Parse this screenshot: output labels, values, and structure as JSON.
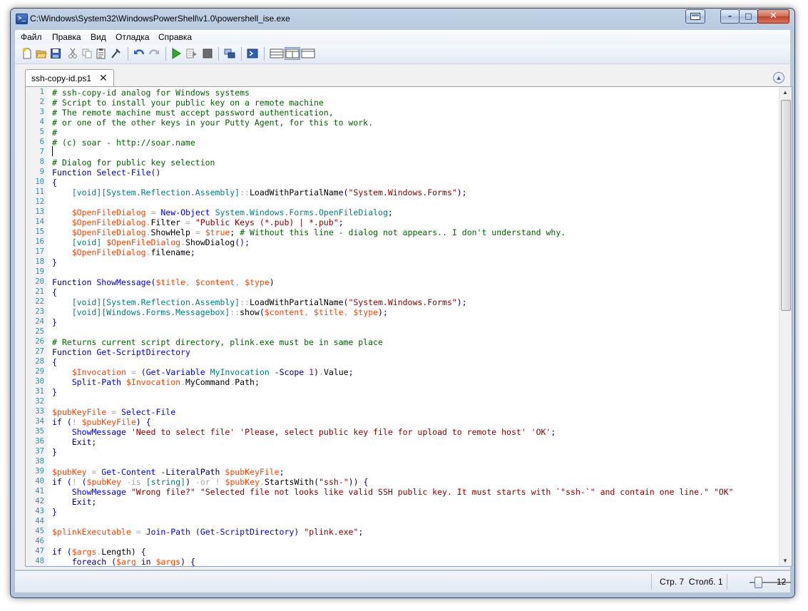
{
  "window": {
    "title": "C:\\Windows\\System32\\WindowsPowerShell\\v1.0\\powershell_ise.exe",
    "min_glyph": "–",
    "max_glyph": "□",
    "close_glyph": "✕"
  },
  "menu": [
    "Файл",
    "Правка",
    "Вид",
    "Отладка",
    "Справка"
  ],
  "tab": {
    "label": "ssh-copy-id.ps1",
    "close_glyph": "✕"
  },
  "editor": {
    "line_numbers": [
      "1",
      "2",
      "3",
      "4",
      "5",
      "6",
      "7",
      "8",
      "9",
      "10",
      "11",
      "12",
      "13",
      "14",
      "15",
      "16",
      "17",
      "18",
      "19",
      "20",
      "21",
      "22",
      "23",
      "24",
      "25",
      "26",
      "27",
      "28",
      "29",
      "30",
      "31",
      "32",
      "33",
      "34",
      "35",
      "36",
      "37",
      "38",
      "39",
      "40",
      "41",
      "42",
      "43",
      "44",
      "45",
      "46",
      "47",
      "48"
    ],
    "lines": [
      [
        [
          "c",
          "# ssh-copy-id analog for Windows systems"
        ]
      ],
      [
        [
          "c",
          "# Script to install your public key on a remote machine"
        ]
      ],
      [
        [
          "c",
          "# The remote machine must accept password authentication,"
        ]
      ],
      [
        [
          "c",
          "# or one of the other keys in your Putty Agent, for this to work."
        ]
      ],
      [
        [
          "c",
          "#"
        ]
      ],
      [
        [
          "c",
          "# (c) soar - http://soar.name"
        ]
      ],
      [],
      [
        [
          "c",
          "# Dialog for public key selection"
        ]
      ],
      [
        [
          "k",
          "Function"
        ],
        [
          "t",
          " "
        ],
        [
          "n",
          "Select-File"
        ],
        [
          "p",
          "()"
        ]
      ],
      [
        [
          "p",
          "{"
        ]
      ],
      [
        [
          "t",
          "    "
        ],
        [
          "y",
          "[void][System.Reflection.Assembly]"
        ],
        [
          "o",
          "::"
        ],
        [
          "m",
          "LoadWithPartialName"
        ],
        [
          "p",
          "("
        ],
        [
          "s",
          "\"System.Windows.Forms\""
        ],
        [
          "p",
          ");"
        ]
      ],
      [],
      [
        [
          "t",
          "    "
        ],
        [
          "v",
          "$OpenFileDialog"
        ],
        [
          "t",
          " "
        ],
        [
          "o",
          "="
        ],
        [
          "t",
          " "
        ],
        [
          "d",
          "New-Object"
        ],
        [
          "t",
          " "
        ],
        [
          "a",
          "System.Windows.Forms.OpenFileDialog"
        ],
        [
          "p",
          ";"
        ]
      ],
      [
        [
          "t",
          "    "
        ],
        [
          "v",
          "$OpenFileDialog"
        ],
        [
          "o",
          "."
        ],
        [
          "m",
          "Filter"
        ],
        [
          "t",
          " "
        ],
        [
          "o",
          "="
        ],
        [
          "t",
          " "
        ],
        [
          "s",
          "\"Public Keys (*.pub) | *.pub\""
        ],
        [
          "p",
          ";"
        ]
      ],
      [
        [
          "t",
          "    "
        ],
        [
          "v",
          "$OpenFileDialog"
        ],
        [
          "o",
          "."
        ],
        [
          "m",
          "ShowHelp"
        ],
        [
          "t",
          " "
        ],
        [
          "o",
          "="
        ],
        [
          "t",
          " "
        ],
        [
          "v",
          "$true"
        ],
        [
          "p",
          ";"
        ],
        [
          "t",
          " "
        ],
        [
          "c",
          "# Without this line - dialog not appears.. I don't understand why."
        ]
      ],
      [
        [
          "t",
          "    "
        ],
        [
          "y",
          "[void]"
        ],
        [
          "t",
          " "
        ],
        [
          "v",
          "$OpenFileDialog"
        ],
        [
          "o",
          "."
        ],
        [
          "m",
          "ShowDialog"
        ],
        [
          "p",
          "();"
        ]
      ],
      [
        [
          "t",
          "    "
        ],
        [
          "v",
          "$OpenFileDialog"
        ],
        [
          "o",
          "."
        ],
        [
          "m",
          "filename"
        ],
        [
          "p",
          ";"
        ]
      ],
      [
        [
          "p",
          "}"
        ]
      ],
      [],
      [
        [
          "k",
          "Function"
        ],
        [
          "t",
          " "
        ],
        [
          "n",
          "ShowMessage"
        ],
        [
          "p",
          "("
        ],
        [
          "v",
          "$title"
        ],
        [
          "o",
          ", "
        ],
        [
          "v",
          "$content"
        ],
        [
          "o",
          ", "
        ],
        [
          "v",
          "$type"
        ],
        [
          "p",
          ")"
        ]
      ],
      [
        [
          "p",
          "{"
        ]
      ],
      [
        [
          "t",
          "    "
        ],
        [
          "y",
          "[void][System.Reflection.Assembly]"
        ],
        [
          "o",
          "::"
        ],
        [
          "m",
          "LoadWithPartialName"
        ],
        [
          "p",
          "("
        ],
        [
          "s",
          "\"System.Windows.Forms\""
        ],
        [
          "p",
          ");"
        ]
      ],
      [
        [
          "t",
          "    "
        ],
        [
          "y",
          "[void][Windows.Forms.Messagebox]"
        ],
        [
          "o",
          "::"
        ],
        [
          "m",
          "show"
        ],
        [
          "p",
          "("
        ],
        [
          "v",
          "$content"
        ],
        [
          "o",
          ", "
        ],
        [
          "v",
          "$title"
        ],
        [
          "o",
          ", "
        ],
        [
          "v",
          "$type"
        ],
        [
          "p",
          ");"
        ]
      ],
      [
        [
          "p",
          "}"
        ]
      ],
      [],
      [
        [
          "c",
          "# Returns current script directory, plink.exe must be in same place"
        ]
      ],
      [
        [
          "k",
          "Function"
        ],
        [
          "t",
          " "
        ],
        [
          "n",
          "Get-ScriptDirectory"
        ]
      ],
      [
        [
          "p",
          "{"
        ]
      ],
      [
        [
          "t",
          "    "
        ],
        [
          "v",
          "$Invocation"
        ],
        [
          "t",
          " "
        ],
        [
          "o",
          "="
        ],
        [
          "t",
          " "
        ],
        [
          "p",
          "("
        ],
        [
          "d",
          "Get-Variable"
        ],
        [
          "t",
          " "
        ],
        [
          "a",
          "MyInvocation"
        ],
        [
          "t",
          " "
        ],
        [
          "e",
          "-Scope"
        ],
        [
          "t",
          " "
        ],
        [
          "u",
          "1"
        ],
        [
          "p",
          ")"
        ],
        [
          "o",
          "."
        ],
        [
          "m",
          "Value"
        ],
        [
          "p",
          ";"
        ]
      ],
      [
        [
          "t",
          "    "
        ],
        [
          "d",
          "Split-Path"
        ],
        [
          "t",
          " "
        ],
        [
          "v",
          "$Invocation"
        ],
        [
          "o",
          "."
        ],
        [
          "m",
          "MyCommand"
        ],
        [
          "o",
          "."
        ],
        [
          "m",
          "Path"
        ],
        [
          "p",
          ";"
        ]
      ],
      [
        [
          "p",
          "}"
        ]
      ],
      [],
      [
        [
          "v",
          "$pubKeyFile"
        ],
        [
          "t",
          " "
        ],
        [
          "o",
          "="
        ],
        [
          "t",
          " "
        ],
        [
          "d",
          "Select-File"
        ]
      ],
      [
        [
          "k",
          "if"
        ],
        [
          "t",
          " "
        ],
        [
          "p",
          "("
        ],
        [
          "o",
          "!"
        ],
        [
          "t",
          " "
        ],
        [
          "v",
          "$pubKeyFile"
        ],
        [
          "p",
          ")"
        ],
        [
          "t",
          " "
        ],
        [
          "p",
          "{"
        ]
      ],
      [
        [
          "t",
          "    "
        ],
        [
          "d",
          "ShowMessage"
        ],
        [
          "t",
          " "
        ],
        [
          "s",
          "'Need to select file'"
        ],
        [
          "t",
          " "
        ],
        [
          "s",
          "'Please, select public key file for upload to remote host'"
        ],
        [
          "t",
          " "
        ],
        [
          "s",
          "'OK'"
        ],
        [
          "p",
          ";"
        ]
      ],
      [
        [
          "t",
          "    "
        ],
        [
          "k",
          "Exit"
        ],
        [
          "p",
          ";"
        ]
      ],
      [
        [
          "p",
          "}"
        ]
      ],
      [],
      [
        [
          "v",
          "$pubKey"
        ],
        [
          "t",
          " "
        ],
        [
          "o",
          "="
        ],
        [
          "t",
          " "
        ],
        [
          "d",
          "Get-Content"
        ],
        [
          "t",
          " "
        ],
        [
          "e",
          "-LiteralPath"
        ],
        [
          "t",
          " "
        ],
        [
          "v",
          "$pubKeyFile"
        ],
        [
          "p",
          ";"
        ]
      ],
      [
        [
          "k",
          "if"
        ],
        [
          "t",
          " "
        ],
        [
          "p",
          "("
        ],
        [
          "o",
          "!"
        ],
        [
          "t",
          " "
        ],
        [
          "p",
          "("
        ],
        [
          "v",
          "$pubKey"
        ],
        [
          "t",
          " "
        ],
        [
          "o",
          "-is"
        ],
        [
          "t",
          " "
        ],
        [
          "y",
          "[string]"
        ],
        [
          "p",
          ")"
        ],
        [
          "t",
          " "
        ],
        [
          "o",
          "-or"
        ],
        [
          "t",
          " "
        ],
        [
          "o",
          "!"
        ],
        [
          "t",
          " "
        ],
        [
          "v",
          "$pubKey"
        ],
        [
          "o",
          "."
        ],
        [
          "m",
          "StartsWith"
        ],
        [
          "p",
          "("
        ],
        [
          "s",
          "\"ssh-\""
        ],
        [
          "p",
          "))"
        ],
        [
          "t",
          " "
        ],
        [
          "p",
          "{"
        ]
      ],
      [
        [
          "t",
          "    "
        ],
        [
          "d",
          "ShowMessage"
        ],
        [
          "t",
          " "
        ],
        [
          "s",
          "\"Wrong file?\""
        ],
        [
          "t",
          " "
        ],
        [
          "s",
          "\"Selected file not looks like valid SSH public key. It must starts with `\"ssh-`\" and contain one line.\""
        ],
        [
          "t",
          " "
        ],
        [
          "s",
          "\"OK\""
        ]
      ],
      [
        [
          "t",
          "    "
        ],
        [
          "k",
          "Exit"
        ],
        [
          "p",
          ";"
        ]
      ],
      [
        [
          "p",
          "}"
        ]
      ],
      [],
      [
        [
          "v",
          "$plinkExecutable"
        ],
        [
          "t",
          " "
        ],
        [
          "o",
          "="
        ],
        [
          "t",
          " "
        ],
        [
          "d",
          "Join-Path"
        ],
        [
          "t",
          " "
        ],
        [
          "p",
          "("
        ],
        [
          "d",
          "Get-ScriptDirectory"
        ],
        [
          "p",
          ")"
        ],
        [
          "t",
          " "
        ],
        [
          "s",
          "\"plink.exe\""
        ],
        [
          "p",
          ";"
        ]
      ],
      [],
      [
        [
          "k",
          "if"
        ],
        [
          "t",
          " "
        ],
        [
          "p",
          "("
        ],
        [
          "v",
          "$args"
        ],
        [
          "o",
          "."
        ],
        [
          "m",
          "Length"
        ],
        [
          "p",
          ")"
        ],
        [
          "t",
          " "
        ],
        [
          "p",
          "{"
        ]
      ],
      [
        [
          "t",
          "    "
        ],
        [
          "k",
          "foreach"
        ],
        [
          "t",
          " "
        ],
        [
          "p",
          "("
        ],
        [
          "v",
          "$arg"
        ],
        [
          "t",
          " "
        ],
        [
          "k",
          "in"
        ],
        [
          "t",
          " "
        ],
        [
          "v",
          "$args"
        ],
        [
          "p",
          ")"
        ],
        [
          "t",
          " "
        ],
        [
          "p",
          "{"
        ]
      ]
    ]
  },
  "status": {
    "position": "Стр. 7  Столб. 1",
    "zoom_value": "12"
  }
}
